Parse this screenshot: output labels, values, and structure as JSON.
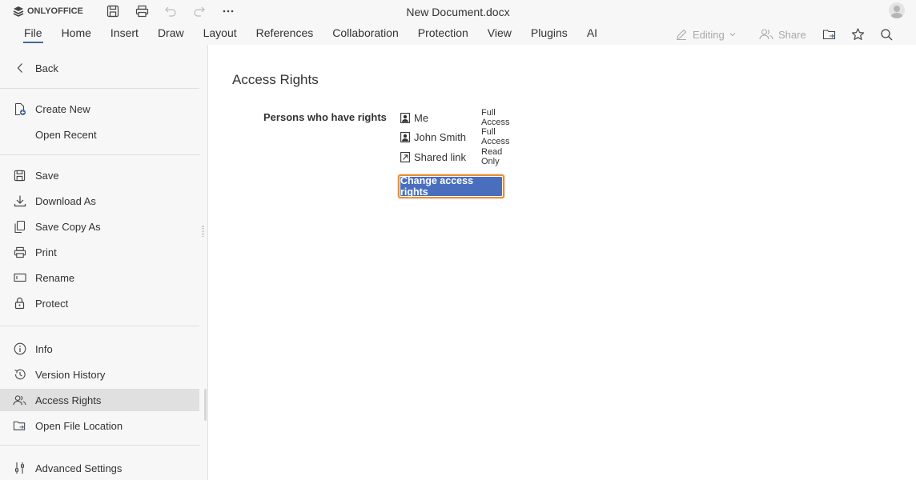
{
  "app": {
    "logo_text": "ONLYOFFICE",
    "document_title": "New Document.docx"
  },
  "toolbar": {
    "quick_access": [
      {
        "name": "save-icon"
      },
      {
        "name": "print-icon"
      },
      {
        "name": "undo-icon"
      },
      {
        "name": "redo-icon"
      },
      {
        "name": "more-icon"
      }
    ],
    "tabs": [
      "File",
      "Home",
      "Insert",
      "Draw",
      "Layout",
      "References",
      "Collaboration",
      "Protection",
      "View",
      "Plugins",
      "AI"
    ],
    "active_tab": "File",
    "editing_label": "Editing",
    "share_label": "Share"
  },
  "sidebar": {
    "back_label": "Back",
    "group1": [
      "Create New",
      "Open Recent"
    ],
    "group2": [
      "Save",
      "Download As",
      "Save Copy As",
      "Print",
      "Rename",
      "Protect"
    ],
    "group3": [
      "Info",
      "Version History",
      "Access Rights",
      "Open File Location"
    ],
    "group4": [
      "Advanced Settings"
    ],
    "selected": "Access Rights"
  },
  "main": {
    "title": "Access Rights",
    "persons_label": "Persons who have rights",
    "rights": [
      {
        "name": "Me",
        "access": "Full Access",
        "icon": "user-icon"
      },
      {
        "name": "John Smith",
        "access": "Full Access",
        "icon": "user-icon"
      },
      {
        "name": "Shared link",
        "access": "Read Only",
        "icon": "external-link-icon"
      }
    ],
    "change_button_label": "Change access rights"
  },
  "colors": {
    "accent": "#446995",
    "button_bg": "#4a6ebe",
    "button_focus_border": "#f08c29",
    "sidebar_bg": "#f7f7f7",
    "selected_bg": "#e0e0e0"
  }
}
